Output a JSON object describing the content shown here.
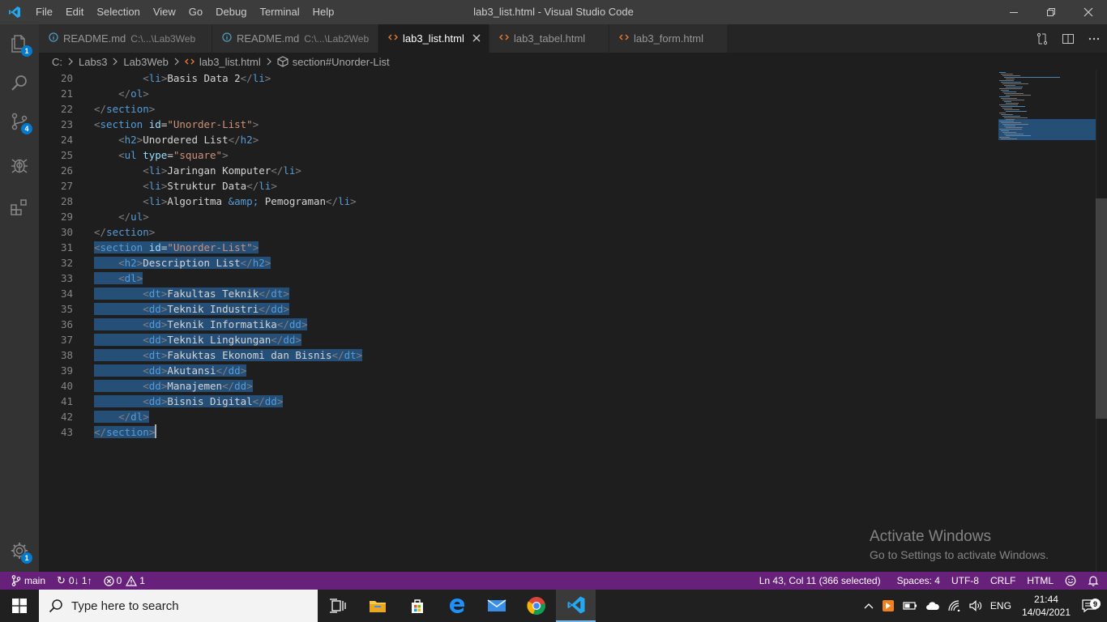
{
  "window": {
    "title": "lab3_list.html - Visual Studio Code",
    "menu": [
      "File",
      "Edit",
      "Selection",
      "View",
      "Go",
      "Debug",
      "Terminal",
      "Help"
    ]
  },
  "activity": {
    "explorer_badge": "1",
    "scm_badge": "4",
    "settings_badge": "1"
  },
  "tabs": [
    {
      "label": "README.md",
      "path": "C:\\...\\Lab3Web",
      "icon": "info-icon",
      "modified": true,
      "active": false
    },
    {
      "label": "README.md",
      "path": "C:\\...\\Lab2Web",
      "icon": "info-icon",
      "modified": false,
      "active": false
    },
    {
      "label": "lab3_list.html",
      "path": "",
      "icon": "html-icon",
      "modified": false,
      "active": true
    },
    {
      "label": "lab3_tabel.html",
      "path": "",
      "icon": "html-icon",
      "modified": false,
      "active": false
    },
    {
      "label": "lab3_form.html",
      "path": "",
      "icon": "html-icon",
      "modified": false,
      "active": false
    }
  ],
  "breadcrumb": [
    "C:",
    "Labs3",
    "Lab3Web",
    "lab3_list.html",
    "section#Unorder-List"
  ],
  "editor": {
    "lines": [
      {
        "n": "20",
        "indent": 2,
        "tokens": [
          [
            "br",
            "<"
          ],
          [
            "tg",
            "li"
          ],
          [
            "br",
            ">"
          ],
          [
            "tx",
            "Basis Data 2"
          ],
          [
            "br",
            "</"
          ],
          [
            "tg",
            "li"
          ],
          [
            "br",
            ">"
          ]
        ]
      },
      {
        "n": "21",
        "indent": 1,
        "tokens": [
          [
            "br",
            "</"
          ],
          [
            "tg",
            "ol"
          ],
          [
            "br",
            ">"
          ]
        ]
      },
      {
        "n": "22",
        "indent": 0,
        "tokens": [
          [
            "br",
            "</"
          ],
          [
            "tg",
            "section"
          ],
          [
            "br",
            ">"
          ]
        ]
      },
      {
        "n": "23",
        "indent": 0,
        "tokens": [
          [
            "br",
            "<"
          ],
          [
            "tg",
            "section"
          ],
          [
            "tx",
            " "
          ],
          [
            "at",
            "id"
          ],
          [
            "tx",
            "="
          ],
          [
            "st",
            "\"Unorder-List\""
          ],
          [
            "br",
            ">"
          ]
        ]
      },
      {
        "n": "24",
        "indent": 1,
        "tokens": [
          [
            "br",
            "<"
          ],
          [
            "tg",
            "h2"
          ],
          [
            "br",
            ">"
          ],
          [
            "tx",
            "Unordered List"
          ],
          [
            "br",
            "</"
          ],
          [
            "tg",
            "h2"
          ],
          [
            "br",
            ">"
          ]
        ]
      },
      {
        "n": "25",
        "indent": 1,
        "tokens": [
          [
            "br",
            "<"
          ],
          [
            "tg",
            "ul"
          ],
          [
            "tx",
            " "
          ],
          [
            "at",
            "type"
          ],
          [
            "tx",
            "="
          ],
          [
            "st",
            "\"square\""
          ],
          [
            "br",
            ">"
          ]
        ]
      },
      {
        "n": "26",
        "indent": 2,
        "tokens": [
          [
            "br",
            "<"
          ],
          [
            "tg",
            "li"
          ],
          [
            "br",
            ">"
          ],
          [
            "tx",
            "Jaringan Komputer"
          ],
          [
            "br",
            "</"
          ],
          [
            "tg",
            "li"
          ],
          [
            "br",
            ">"
          ]
        ]
      },
      {
        "n": "27",
        "indent": 2,
        "tokens": [
          [
            "br",
            "<"
          ],
          [
            "tg",
            "li"
          ],
          [
            "br",
            ">"
          ],
          [
            "tx",
            "Struktur Data"
          ],
          [
            "br",
            "</"
          ],
          [
            "tg",
            "li"
          ],
          [
            "br",
            ">"
          ]
        ]
      },
      {
        "n": "28",
        "indent": 2,
        "tokens": [
          [
            "br",
            "<"
          ],
          [
            "tg",
            "li"
          ],
          [
            "br",
            ">"
          ],
          [
            "tx",
            "Algoritma "
          ],
          [
            "en",
            "&amp;"
          ],
          [
            "tx",
            " Pemograman"
          ],
          [
            "br",
            "</"
          ],
          [
            "tg",
            "li"
          ],
          [
            "br",
            ">"
          ]
        ]
      },
      {
        "n": "29",
        "indent": 1,
        "tokens": [
          [
            "br",
            "</"
          ],
          [
            "tg",
            "ul"
          ],
          [
            "br",
            ">"
          ]
        ]
      },
      {
        "n": "30",
        "indent": 0,
        "tokens": [
          [
            "br",
            "</"
          ],
          [
            "tg",
            "section"
          ],
          [
            "br",
            ">"
          ]
        ]
      },
      {
        "n": "31",
        "indent": 0,
        "sel": true,
        "tokens": [
          [
            "br",
            "<"
          ],
          [
            "tg",
            "section"
          ],
          [
            "tx",
            " "
          ],
          [
            "at",
            "id"
          ],
          [
            "tx",
            "="
          ],
          [
            "st",
            "\"Unorder-List\""
          ],
          [
            "br",
            ">"
          ]
        ]
      },
      {
        "n": "32",
        "indent": 1,
        "sel": true,
        "tokens": [
          [
            "br",
            "<"
          ],
          [
            "tg",
            "h2"
          ],
          [
            "br",
            ">"
          ],
          [
            "tx",
            "Description List"
          ],
          [
            "br",
            "</"
          ],
          [
            "tg",
            "h2"
          ],
          [
            "br",
            ">"
          ]
        ]
      },
      {
        "n": "33",
        "indent": 1,
        "sel": true,
        "tokens": [
          [
            "br",
            "<"
          ],
          [
            "tg",
            "dl"
          ],
          [
            "br",
            ">"
          ]
        ]
      },
      {
        "n": "34",
        "indent": 2,
        "sel": true,
        "tokens": [
          [
            "br",
            "<"
          ],
          [
            "tg",
            "dt"
          ],
          [
            "br",
            ">"
          ],
          [
            "tx",
            "Fakultas Teknik"
          ],
          [
            "br",
            "</"
          ],
          [
            "tg",
            "dt"
          ],
          [
            "br",
            ">"
          ]
        ]
      },
      {
        "n": "35",
        "indent": 2,
        "sel": true,
        "tokens": [
          [
            "br",
            "<"
          ],
          [
            "tg",
            "dd"
          ],
          [
            "br",
            ">"
          ],
          [
            "tx",
            "Teknik Industri"
          ],
          [
            "br",
            "</"
          ],
          [
            "tg",
            "dd"
          ],
          [
            "br",
            ">"
          ]
        ]
      },
      {
        "n": "36",
        "indent": 2,
        "sel": true,
        "tokens": [
          [
            "br",
            "<"
          ],
          [
            "tg",
            "dd"
          ],
          [
            "br",
            ">"
          ],
          [
            "tx",
            "Teknik Informatika"
          ],
          [
            "br",
            "</"
          ],
          [
            "tg",
            "dd"
          ],
          [
            "br",
            ">"
          ]
        ]
      },
      {
        "n": "37",
        "indent": 2,
        "sel": true,
        "tokens": [
          [
            "br",
            "<"
          ],
          [
            "tg",
            "dd"
          ],
          [
            "br",
            ">"
          ],
          [
            "tx",
            "Teknik Lingkungan"
          ],
          [
            "br",
            "</"
          ],
          [
            "tg",
            "dd"
          ],
          [
            "br",
            ">"
          ]
        ]
      },
      {
        "n": "38",
        "indent": 2,
        "sel": true,
        "tokens": [
          [
            "br",
            "<"
          ],
          [
            "tg",
            "dt"
          ],
          [
            "br",
            ">"
          ],
          [
            "tx",
            "Fakuktas Ekonomi dan Bisnis"
          ],
          [
            "br",
            "</"
          ],
          [
            "tg",
            "dt"
          ],
          [
            "br",
            ">"
          ]
        ]
      },
      {
        "n": "39",
        "indent": 2,
        "sel": true,
        "tokens": [
          [
            "br",
            "<"
          ],
          [
            "tg",
            "dd"
          ],
          [
            "br",
            ">"
          ],
          [
            "tx",
            "Akutansi"
          ],
          [
            "br",
            "</"
          ],
          [
            "tg",
            "dd"
          ],
          [
            "br",
            ">"
          ]
        ]
      },
      {
        "n": "40",
        "indent": 2,
        "sel": true,
        "tokens": [
          [
            "br",
            "<"
          ],
          [
            "tg",
            "dd"
          ],
          [
            "br",
            ">"
          ],
          [
            "tx",
            "Manajemen"
          ],
          [
            "br",
            "</"
          ],
          [
            "tg",
            "dd"
          ],
          [
            "br",
            ">"
          ]
        ]
      },
      {
        "n": "41",
        "indent": 2,
        "sel": true,
        "tokens": [
          [
            "br",
            "<"
          ],
          [
            "tg",
            "dd"
          ],
          [
            "br",
            ">"
          ],
          [
            "tx",
            "Bisnis Digital"
          ],
          [
            "br",
            "</"
          ],
          [
            "tg",
            "dd"
          ],
          [
            "br",
            ">"
          ]
        ]
      },
      {
        "n": "42",
        "indent": 1,
        "sel": true,
        "tokens": [
          [
            "br",
            "</"
          ],
          [
            "tg",
            "dl"
          ],
          [
            "br",
            ">"
          ]
        ]
      },
      {
        "n": "43",
        "indent": 0,
        "sel": true,
        "cursor": true,
        "tokens": [
          [
            "br",
            "</"
          ],
          [
            "tg",
            "section"
          ],
          [
            "br",
            ">"
          ]
        ]
      }
    ]
  },
  "watermark": {
    "line1": "Activate Windows",
    "line2": "Go to Settings to activate Windows."
  },
  "statusbar": {
    "branch": "main",
    "sync": "0↓ 1↑",
    "errors": "0",
    "warnings": "1",
    "position": "Ln 43, Col 11 (366 selected)",
    "spaces": "Spaces: 4",
    "encoding": "UTF-8",
    "eol": "CRLF",
    "language": "HTML",
    "color": "#68217a"
  },
  "taskbar": {
    "search_placeholder": "Type here to search",
    "language": "ENG",
    "time": "21:44",
    "date": "14/04/2021",
    "notifications": "9"
  }
}
